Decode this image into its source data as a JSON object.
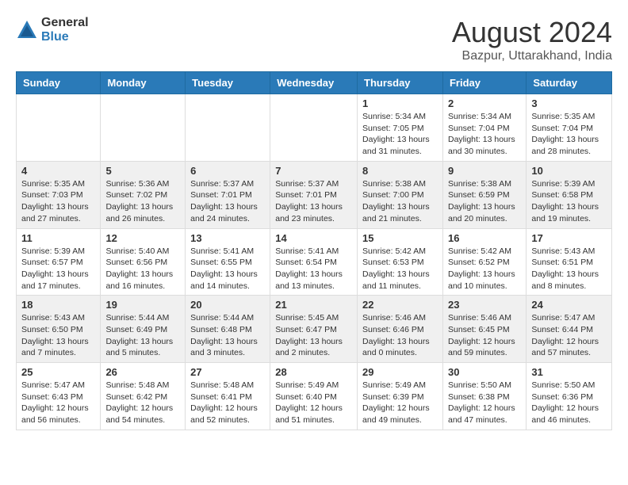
{
  "header": {
    "logo": {
      "general": "General",
      "blue": "Blue"
    },
    "title": "August 2024",
    "location": "Bazpur, Uttarakhand, India"
  },
  "weekdays": [
    "Sunday",
    "Monday",
    "Tuesday",
    "Wednesday",
    "Thursday",
    "Friday",
    "Saturday"
  ],
  "weeks": [
    {
      "bg": "light",
      "days": [
        {
          "num": "",
          "info": ""
        },
        {
          "num": "",
          "info": ""
        },
        {
          "num": "",
          "info": ""
        },
        {
          "num": "",
          "info": ""
        },
        {
          "num": "1",
          "info": "Sunrise: 5:34 AM\nSunset: 7:05 PM\nDaylight: 13 hours\nand 31 minutes."
        },
        {
          "num": "2",
          "info": "Sunrise: 5:34 AM\nSunset: 7:04 PM\nDaylight: 13 hours\nand 30 minutes."
        },
        {
          "num": "3",
          "info": "Sunrise: 5:35 AM\nSunset: 7:04 PM\nDaylight: 13 hours\nand 28 minutes."
        }
      ]
    },
    {
      "bg": "gray",
      "days": [
        {
          "num": "4",
          "info": "Sunrise: 5:35 AM\nSunset: 7:03 PM\nDaylight: 13 hours\nand 27 minutes."
        },
        {
          "num": "5",
          "info": "Sunrise: 5:36 AM\nSunset: 7:02 PM\nDaylight: 13 hours\nand 26 minutes."
        },
        {
          "num": "6",
          "info": "Sunrise: 5:37 AM\nSunset: 7:01 PM\nDaylight: 13 hours\nand 24 minutes."
        },
        {
          "num": "7",
          "info": "Sunrise: 5:37 AM\nSunset: 7:01 PM\nDaylight: 13 hours\nand 23 minutes."
        },
        {
          "num": "8",
          "info": "Sunrise: 5:38 AM\nSunset: 7:00 PM\nDaylight: 13 hours\nand 21 minutes."
        },
        {
          "num": "9",
          "info": "Sunrise: 5:38 AM\nSunset: 6:59 PM\nDaylight: 13 hours\nand 20 minutes."
        },
        {
          "num": "10",
          "info": "Sunrise: 5:39 AM\nSunset: 6:58 PM\nDaylight: 13 hours\nand 19 minutes."
        }
      ]
    },
    {
      "bg": "light",
      "days": [
        {
          "num": "11",
          "info": "Sunrise: 5:39 AM\nSunset: 6:57 PM\nDaylight: 13 hours\nand 17 minutes."
        },
        {
          "num": "12",
          "info": "Sunrise: 5:40 AM\nSunset: 6:56 PM\nDaylight: 13 hours\nand 16 minutes."
        },
        {
          "num": "13",
          "info": "Sunrise: 5:41 AM\nSunset: 6:55 PM\nDaylight: 13 hours\nand 14 minutes."
        },
        {
          "num": "14",
          "info": "Sunrise: 5:41 AM\nSunset: 6:54 PM\nDaylight: 13 hours\nand 13 minutes."
        },
        {
          "num": "15",
          "info": "Sunrise: 5:42 AM\nSunset: 6:53 PM\nDaylight: 13 hours\nand 11 minutes."
        },
        {
          "num": "16",
          "info": "Sunrise: 5:42 AM\nSunset: 6:52 PM\nDaylight: 13 hours\nand 10 minutes."
        },
        {
          "num": "17",
          "info": "Sunrise: 5:43 AM\nSunset: 6:51 PM\nDaylight: 13 hours\nand 8 minutes."
        }
      ]
    },
    {
      "bg": "gray",
      "days": [
        {
          "num": "18",
          "info": "Sunrise: 5:43 AM\nSunset: 6:50 PM\nDaylight: 13 hours\nand 7 minutes."
        },
        {
          "num": "19",
          "info": "Sunrise: 5:44 AM\nSunset: 6:49 PM\nDaylight: 13 hours\nand 5 minutes."
        },
        {
          "num": "20",
          "info": "Sunrise: 5:44 AM\nSunset: 6:48 PM\nDaylight: 13 hours\nand 3 minutes."
        },
        {
          "num": "21",
          "info": "Sunrise: 5:45 AM\nSunset: 6:47 PM\nDaylight: 13 hours\nand 2 minutes."
        },
        {
          "num": "22",
          "info": "Sunrise: 5:46 AM\nSunset: 6:46 PM\nDaylight: 13 hours\nand 0 minutes."
        },
        {
          "num": "23",
          "info": "Sunrise: 5:46 AM\nSunset: 6:45 PM\nDaylight: 12 hours\nand 59 minutes."
        },
        {
          "num": "24",
          "info": "Sunrise: 5:47 AM\nSunset: 6:44 PM\nDaylight: 12 hours\nand 57 minutes."
        }
      ]
    },
    {
      "bg": "light",
      "days": [
        {
          "num": "25",
          "info": "Sunrise: 5:47 AM\nSunset: 6:43 PM\nDaylight: 12 hours\nand 56 minutes."
        },
        {
          "num": "26",
          "info": "Sunrise: 5:48 AM\nSunset: 6:42 PM\nDaylight: 12 hours\nand 54 minutes."
        },
        {
          "num": "27",
          "info": "Sunrise: 5:48 AM\nSunset: 6:41 PM\nDaylight: 12 hours\nand 52 minutes."
        },
        {
          "num": "28",
          "info": "Sunrise: 5:49 AM\nSunset: 6:40 PM\nDaylight: 12 hours\nand 51 minutes."
        },
        {
          "num": "29",
          "info": "Sunrise: 5:49 AM\nSunset: 6:39 PM\nDaylight: 12 hours\nand 49 minutes."
        },
        {
          "num": "30",
          "info": "Sunrise: 5:50 AM\nSunset: 6:38 PM\nDaylight: 12 hours\nand 47 minutes."
        },
        {
          "num": "31",
          "info": "Sunrise: 5:50 AM\nSunset: 6:36 PM\nDaylight: 12 hours\nand 46 minutes."
        }
      ]
    }
  ]
}
